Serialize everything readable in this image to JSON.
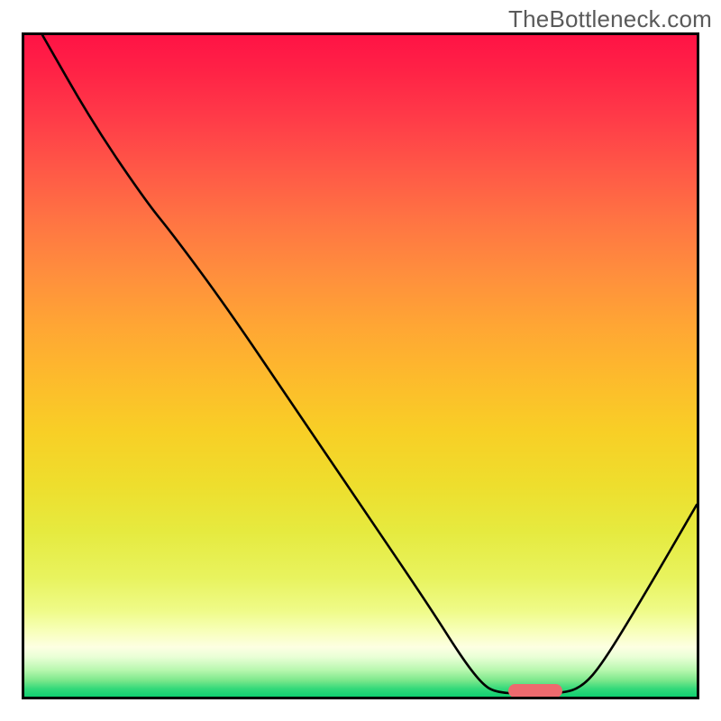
{
  "watermark": "TheBottleneck.com",
  "chart_data": {
    "type": "line",
    "title": "",
    "xlabel": "",
    "ylabel": "",
    "xlim": [
      0,
      100
    ],
    "ylim": [
      0,
      100
    ],
    "grid": false,
    "legend": false,
    "note": "Values are approximate, read from pixel positions (origin bottom-left, 0–100 each axis).",
    "curve_points": [
      {
        "x": 2.7,
        "y": 100.0
      },
      {
        "x": 10.0,
        "y": 87.0
      },
      {
        "x": 18.0,
        "y": 75.0
      },
      {
        "x": 22.0,
        "y": 70.0
      },
      {
        "x": 30.0,
        "y": 59.0
      },
      {
        "x": 40.0,
        "y": 44.0
      },
      {
        "x": 50.0,
        "y": 29.0
      },
      {
        "x": 60.0,
        "y": 14.0
      },
      {
        "x": 65.0,
        "y": 6.0
      },
      {
        "x": 68.0,
        "y": 2.0
      },
      {
        "x": 70.0,
        "y": 0.7
      },
      {
        "x": 74.0,
        "y": 0.4
      },
      {
        "x": 80.0,
        "y": 0.5
      },
      {
        "x": 83.0,
        "y": 1.5
      },
      {
        "x": 86.0,
        "y": 5.0
      },
      {
        "x": 92.0,
        "y": 15.0
      },
      {
        "x": 100.0,
        "y": 29.0
      }
    ],
    "marker": {
      "x_start": 72.0,
      "x_end": 80.0,
      "y": 0.9,
      "color": "#ed6a6e"
    },
    "background_gradient_stops": [
      {
        "pos": 0.0,
        "color": "#ff1345"
      },
      {
        "pos": 0.5,
        "color": "#fdbb2c"
      },
      {
        "pos": 0.88,
        "color": "#effb88"
      },
      {
        "pos": 1.0,
        "color": "#0fd071"
      }
    ]
  }
}
